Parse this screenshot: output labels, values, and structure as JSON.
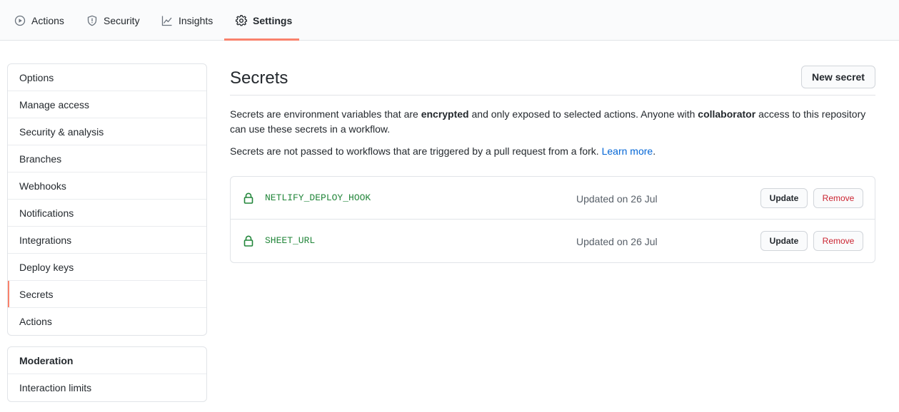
{
  "topnav": {
    "tabs": [
      {
        "label": "Actions",
        "icon": "play-icon"
      },
      {
        "label": "Security",
        "icon": "shield-icon"
      },
      {
        "label": "Insights",
        "icon": "graph-icon"
      },
      {
        "label": "Settings",
        "icon": "gear-icon",
        "selected": true
      }
    ],
    "accent_color": "#f9826c"
  },
  "sidebar": {
    "items": [
      "Options",
      "Manage access",
      "Security & analysis",
      "Branches",
      "Webhooks",
      "Notifications",
      "Integrations",
      "Deploy keys",
      "Secrets",
      "Actions"
    ],
    "selected": "Secrets",
    "moderation": {
      "heading": "Moderation",
      "items": [
        "Interaction limits"
      ]
    }
  },
  "main": {
    "title": "Secrets",
    "new_secret_label": "New secret",
    "desc1": {
      "part1": "Secrets are environment variables that are ",
      "bold1": "encrypted",
      "part2": " and only exposed to selected actions. Anyone with ",
      "bold2": "collaborator",
      "part3": " access to this repository can use these secrets in a workflow."
    },
    "desc2": {
      "text": "Secrets are not passed to workflows that are triggered by a pull request from a fork. ",
      "link": "Learn more",
      "end": "."
    },
    "secrets": [
      {
        "name": "NETLIFY_DEPLOY_HOOK",
        "updated": "Updated on 26 Jul",
        "update_label": "Update",
        "remove_label": "Remove"
      },
      {
        "name": "SHEET_URL",
        "updated": "Updated on 26 Jul",
        "update_label": "Update",
        "remove_label": "Remove"
      }
    ],
    "colors": {
      "secret_name": "#22863a",
      "link": "#0366d6",
      "danger": "#cb2431"
    }
  }
}
